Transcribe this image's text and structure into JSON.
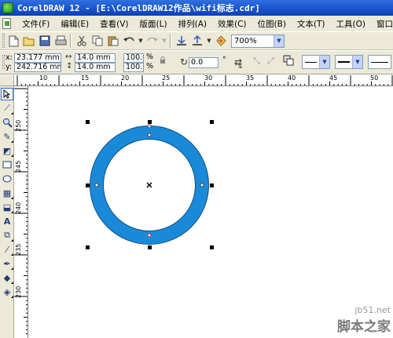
{
  "window": {
    "title": "CorelDRAW 12 - [E:\\CorelDRAW12作品\\wifi标志.cdr]"
  },
  "menubar": {
    "items": [
      {
        "label": "文件(F)"
      },
      {
        "label": "编辑(E)"
      },
      {
        "label": "查看(V)"
      },
      {
        "label": "版面(L)"
      },
      {
        "label": "排列(A)"
      },
      {
        "label": "效果(C)"
      },
      {
        "label": "位图(B)"
      },
      {
        "label": "文本(T)"
      },
      {
        "label": "工具(O)"
      },
      {
        "label": "窗口"
      }
    ]
  },
  "toolbar": {
    "zoom_value": "700%",
    "buttons": [
      "new-icon",
      "open-icon",
      "save-icon",
      "print-icon",
      "cut-icon",
      "copy-icon",
      "paste-icon",
      "undo-icon",
      "redo-icon",
      "import-icon",
      "export-icon",
      "launcher-icon"
    ]
  },
  "propertybar": {
    "x_label": "x:",
    "y_label": "y:",
    "x_value": "23.177 mm",
    "y_value": "242.716 mm",
    "width_value": "14.0 mm",
    "height_value": "14.0 mm",
    "scale_x": "100.0",
    "scale_y": "100.0",
    "percent_symbol": "%",
    "angle_value": "0.0",
    "degree_symbol": "°"
  },
  "rulers": {
    "horizontal_labels": [
      "10",
      "15",
      "20",
      "25",
      "30",
      "35",
      "40",
      "45",
      "50"
    ],
    "vertical_labels": [
      "250",
      "245",
      "240",
      "235",
      "230"
    ]
  },
  "watermark": {
    "site": "jb51.net",
    "name": "脚本之家"
  },
  "colors": {
    "ring_fill": "#1a8ad8",
    "ring_outline": "#0b4f86",
    "titlebar": "#0a3fb8",
    "chrome": "#ece9d8"
  }
}
